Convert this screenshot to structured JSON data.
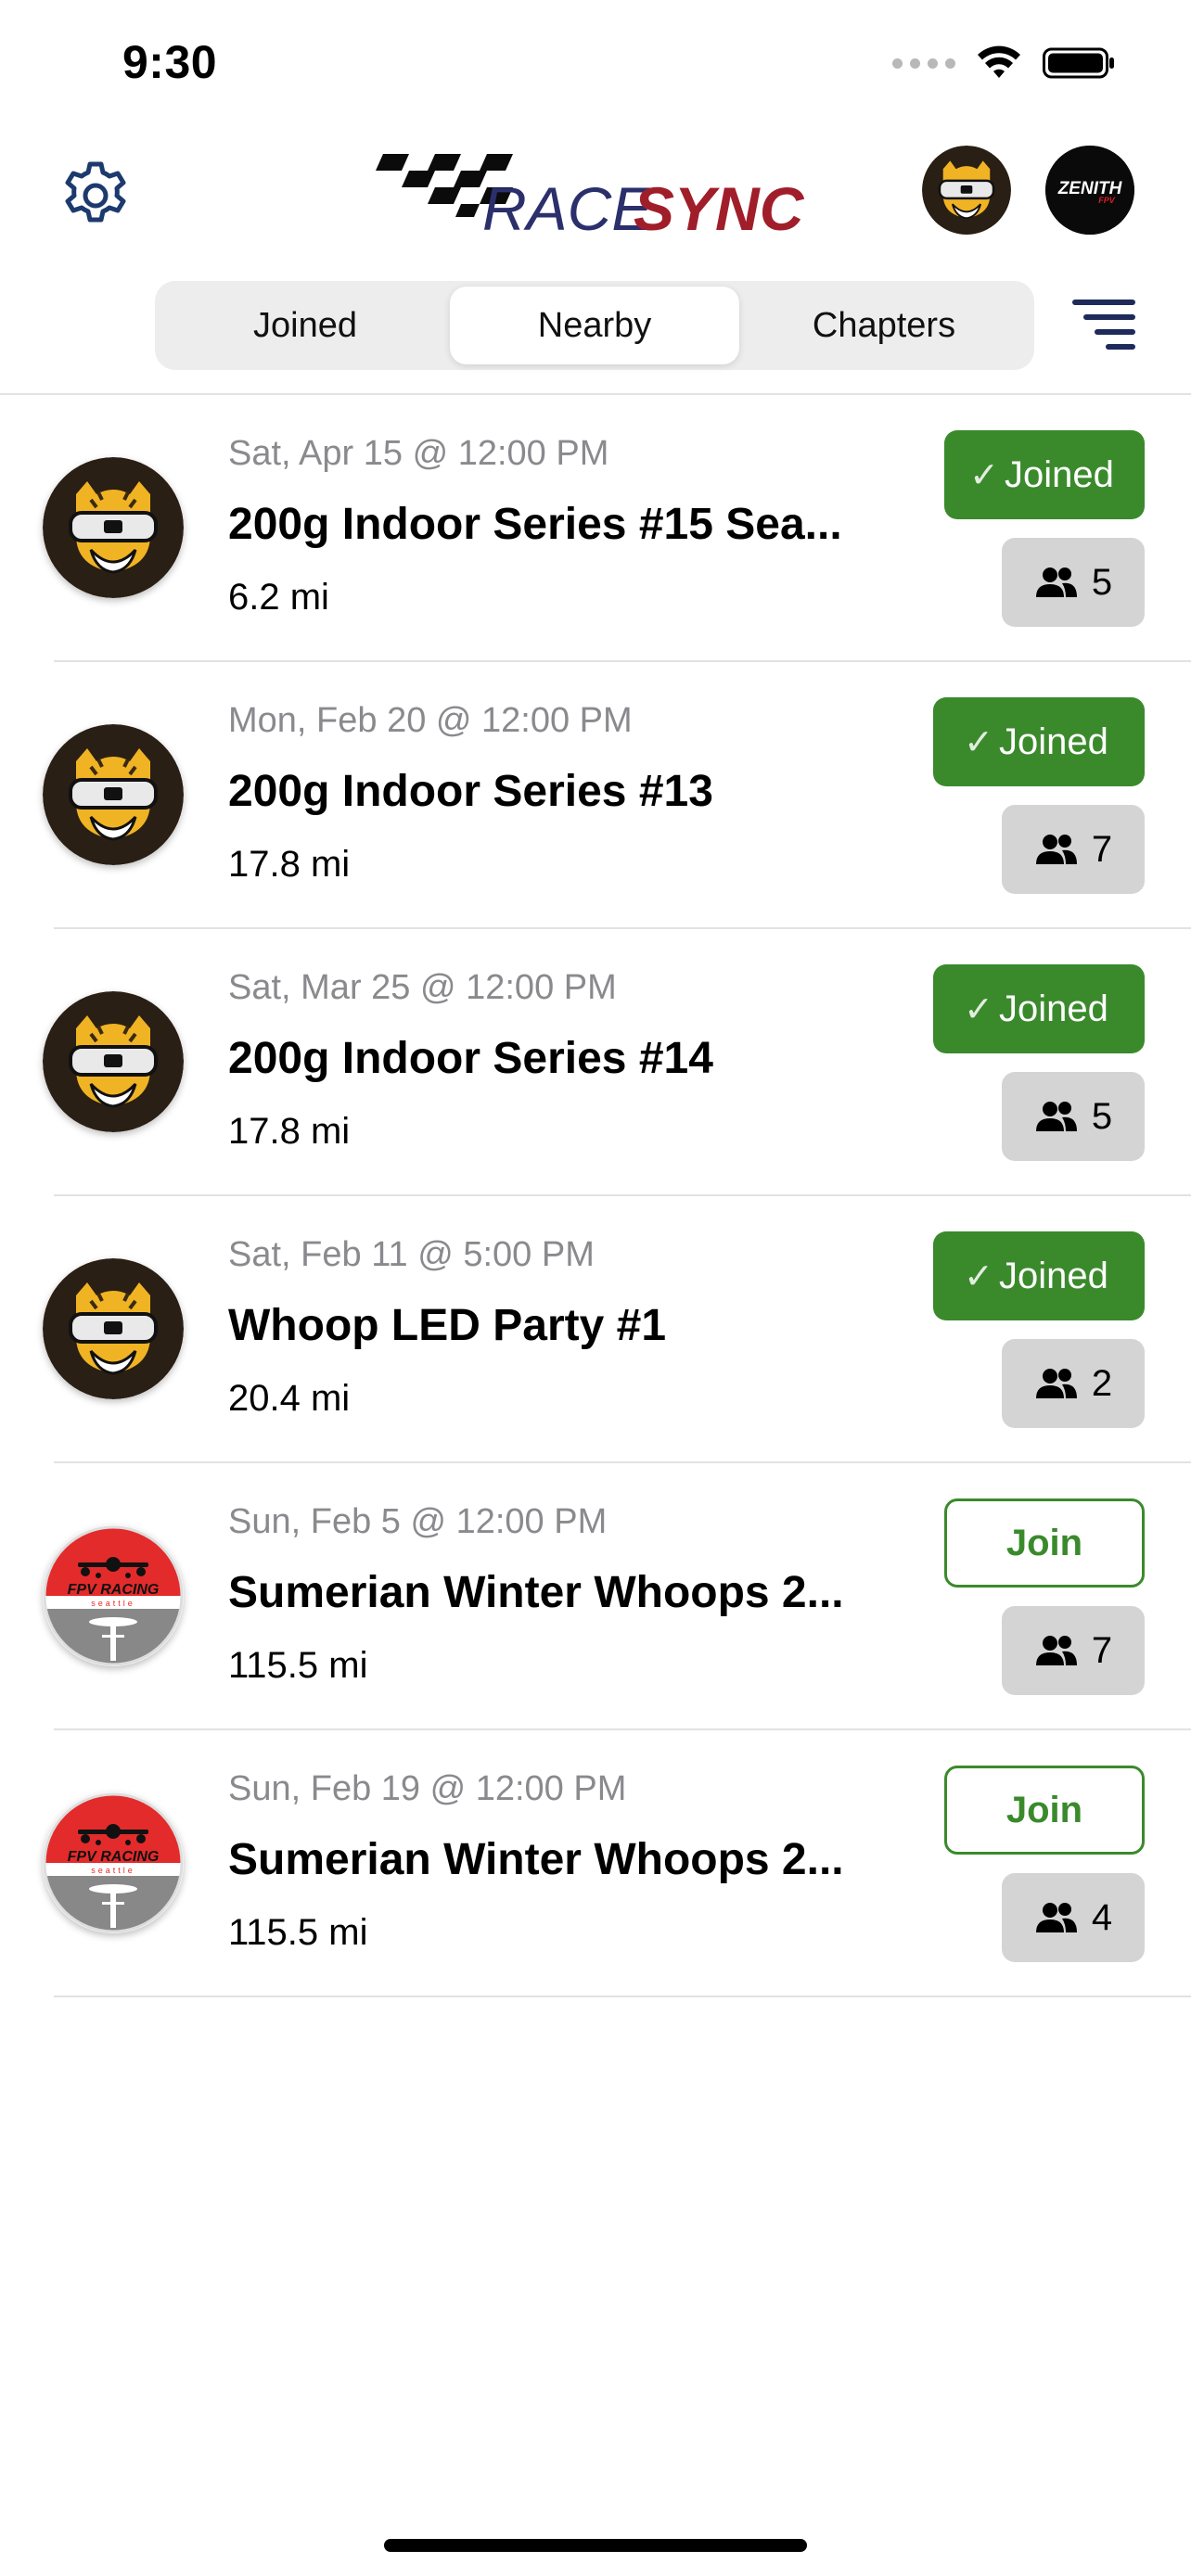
{
  "status_bar": {
    "time": "9:30"
  },
  "header": {
    "logo_text_part1": "RACE",
    "logo_text_part2": "SYNC"
  },
  "segments": [
    {
      "label": "Joined",
      "active": false
    },
    {
      "label": "Nearby",
      "active": true
    },
    {
      "label": "Chapters",
      "active": false
    }
  ],
  "events": [
    {
      "date": "Sat, Apr 15 @ 12:00 PM",
      "title": "200g Indoor Series #15 Sea...",
      "distance": "6.2 mi",
      "status": "Joined",
      "joined": true,
      "members": "5",
      "avatar": "tiger-goggles"
    },
    {
      "date": "Mon, Feb 20 @ 12:00 PM",
      "title": "200g Indoor Series #13",
      "distance": "17.8 mi",
      "status": "Joined",
      "joined": true,
      "members": "7",
      "avatar": "tiger-goggles"
    },
    {
      "date": "Sat, Mar 25 @ 12:00 PM",
      "title": "200g Indoor Series #14",
      "distance": "17.8 mi",
      "status": "Joined",
      "joined": true,
      "members": "5",
      "avatar": "tiger-goggles"
    },
    {
      "date": "Sat, Feb 11 @ 5:00 PM",
      "title": "Whoop LED Party #1",
      "distance": "20.4 mi",
      "status": "Joined",
      "joined": true,
      "members": "2",
      "avatar": "tiger-goggles"
    },
    {
      "date": "Sun, Feb 5 @ 12:00 PM",
      "title": "Sumerian Winter Whoops 2...",
      "distance": "115.5 mi",
      "status": "Join",
      "joined": false,
      "members": "7",
      "avatar": "fpv-racing-seattle"
    },
    {
      "date": "Sun, Feb 19 @ 12:00 PM",
      "title": "Sumerian Winter Whoops 2...",
      "distance": "115.5 mi",
      "status": "Join",
      "joined": false,
      "members": "4",
      "avatar": "fpv-racing-seattle"
    }
  ],
  "avatar_logo_text": {
    "fpv": "FPV RACING",
    "seattle": "seattle",
    "zenith": "ZENITH",
    "zenith_sub": "FPV"
  },
  "colors": {
    "accent_green": "#3a8a2c",
    "logo_navy": "#2b2f6b",
    "logo_red": "#a01e2a",
    "icon_navy": "#1d3a6e"
  }
}
